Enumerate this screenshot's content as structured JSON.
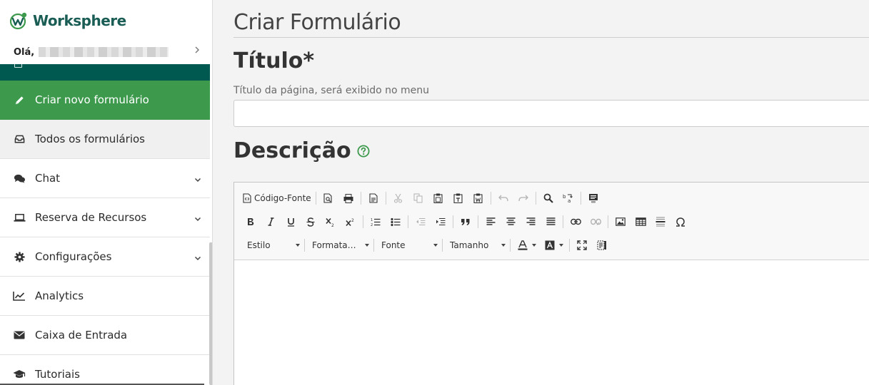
{
  "brand": {
    "name": "Worksphere"
  },
  "user": {
    "greeting": "Olá,"
  },
  "sidebar": {
    "items": [
      {
        "label": "Criar novo formulário",
        "icon": "pencil-icon",
        "state": "active"
      },
      {
        "label": "Todos os formulários",
        "icon": "inbox-icon",
        "state": "selected"
      },
      {
        "label": "Chat",
        "icon": "chat-bubbles-icon",
        "has_submenu": true
      },
      {
        "label": "Reserva de Recursos",
        "icon": "laptop-icon",
        "has_submenu": true
      },
      {
        "label": "Configurações",
        "icon": "gear-icon",
        "has_submenu": true
      },
      {
        "label": "Analytics",
        "icon": "line-chart-icon"
      },
      {
        "label": "Caixa de Entrada",
        "icon": "envelope-icon"
      },
      {
        "label": "Tutoriais",
        "icon": "graduation-cap-icon"
      }
    ]
  },
  "main": {
    "page_title": "Criar Formulário",
    "title_label": "Título*",
    "title_help": "Título da página, será exibido no menu",
    "title_value": "",
    "description_label": "Descrição"
  },
  "editor": {
    "source_label": "Código-Fonte",
    "style_combo": "Estilo",
    "format_combo": "Formata…",
    "font_combo": "Fonte",
    "size_combo": "Tamanho"
  },
  "colors": {
    "brand": "#1a5d55",
    "active_item": "#3d9a4d",
    "dark_bar": "#005951",
    "help_icon": "#3d9a4d"
  }
}
